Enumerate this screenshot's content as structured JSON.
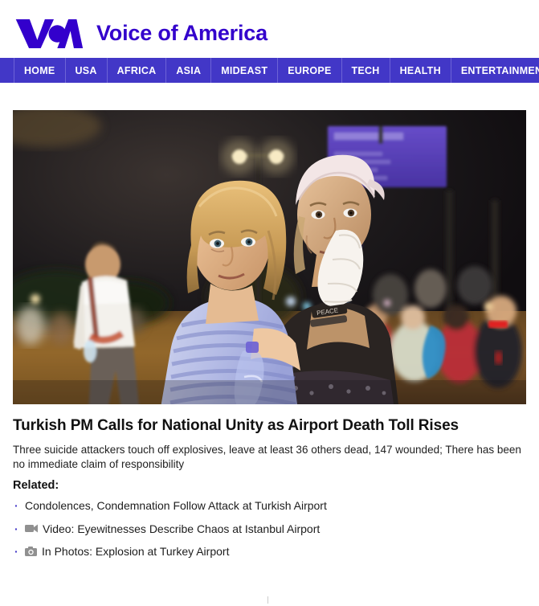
{
  "site": {
    "logo_icon": "voa-logo-icon",
    "wordmark": "Voice of America",
    "brand_color": "#3300CC",
    "nav_color": "#4237C7"
  },
  "nav": {
    "items": [
      {
        "label": "HOME",
        "name": "nav-item-home"
      },
      {
        "label": "USA",
        "name": "nav-item-usa"
      },
      {
        "label": "AFRICA",
        "name": "nav-item-africa"
      },
      {
        "label": "ASIA",
        "name": "nav-item-asia"
      },
      {
        "label": "MIDEAST",
        "name": "nav-item-mideast"
      },
      {
        "label": "EUROPE",
        "name": "nav-item-europe"
      },
      {
        "label": "TECH",
        "name": "nav-item-tech"
      },
      {
        "label": "HEALTH",
        "name": "nav-item-health"
      },
      {
        "label": "ENTERTAINMENT",
        "name": "nav-item-entertainment"
      }
    ]
  },
  "article": {
    "hero_image_alt": "Two women embrace outside Istanbul Ataturk airport at night after the attack",
    "headline": "Turkish PM Calls for National Unity as Airport Death Toll Rises",
    "standfirst": "Three suicide attackers touch off explosives, leave at least 36 others dead, 147 wounded; There has been no immediate claim of responsibility",
    "related_label": "Related:",
    "related": [
      {
        "bullet": "·",
        "icon": null,
        "text": "Condolences, Condemnation Follow Attack at Turkish Airport"
      },
      {
        "bullet": "·",
        "icon": "video-camera-icon",
        "text": "Video: Eyewitnesses Describe Chaos at Istanbul Airport"
      },
      {
        "bullet": "·",
        "icon": "photo-camera-icon",
        "text": "In Photos: Explosion at Turkey Airport"
      }
    ]
  }
}
